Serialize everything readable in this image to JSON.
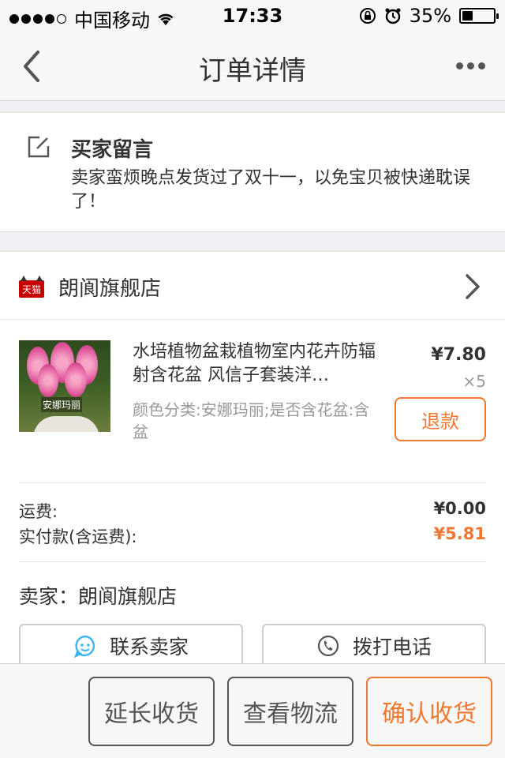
{
  "status_bar": {
    "carrier": "中国移动",
    "time": "17:33",
    "battery_percent_text": "35%",
    "battery_level": 0.35,
    "icons": [
      "signal-dots",
      "wifi-icon",
      "rotation-lock-icon",
      "alarm-icon",
      "battery-icon"
    ]
  },
  "nav": {
    "title": "订单详情",
    "back_icon": "back-chevron-icon",
    "more_icon": "more-dots-icon"
  },
  "buyer_message": {
    "title": "买家留言",
    "text": "卖家蛮烦晚点发货过了双十一，以免宝贝被快递耽误了！",
    "icon": "edit-icon"
  },
  "shop": {
    "badge": "天猫",
    "name": "朗阆旗舰店",
    "chevron_icon": "chevron-right-icon"
  },
  "item": {
    "image_caption": "安娜玛丽",
    "title": "水培植物盆栽植物室内花卉防辐射含花盆 风信子套装洋…",
    "spec": "颜色分类:安娜玛丽;是否含花盆:含盆",
    "price": "¥7.80",
    "quantity": "×5",
    "refund_label": "退款"
  },
  "fees": {
    "shipping_label": "运费:",
    "shipping_value": "¥0.00",
    "paid_label": "实付款(含运费):",
    "paid_value": "¥5.81"
  },
  "seller": {
    "label": "卖家：",
    "name": "朗阆旗舰店",
    "contact_label": "联系卖家",
    "call_label": "拨打电话"
  },
  "bottom_actions": {
    "extend_label": "延长收货",
    "logistics_label": "查看物流",
    "confirm_label": "确认收货"
  },
  "colors": {
    "accent": "#f07830",
    "background": "#efeff4",
    "chat_icon": "#3cb4f0"
  }
}
